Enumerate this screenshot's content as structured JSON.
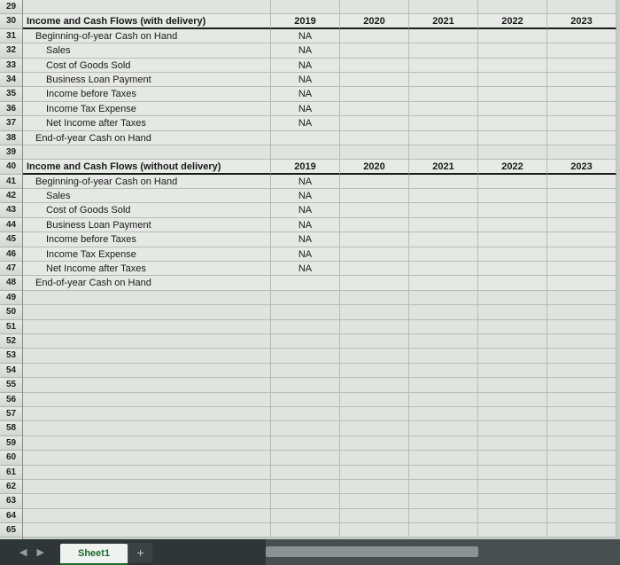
{
  "rows": [
    {
      "n": 29,
      "type": "blank",
      "label": "",
      "cells": [
        "",
        "",
        "",
        "",
        ""
      ]
    },
    {
      "n": 30,
      "type": "header",
      "label": "Income and Cash Flows (with delivery)",
      "cells": [
        "2019",
        "2020",
        "2021",
        "2022",
        "2023"
      ]
    },
    {
      "n": 31,
      "type": "data",
      "indent": 1,
      "label": "Beginning-of-year Cash on Hand",
      "cells": [
        "NA",
        "",
        "",
        "",
        ""
      ]
    },
    {
      "n": 32,
      "type": "data",
      "indent": 2,
      "label": "Sales",
      "cells": [
        "NA",
        "",
        "",
        "",
        ""
      ]
    },
    {
      "n": 33,
      "type": "data",
      "indent": 2,
      "label": "Cost of Goods Sold",
      "cells": [
        "NA",
        "",
        "",
        "",
        ""
      ]
    },
    {
      "n": 34,
      "type": "data",
      "indent": 2,
      "label": "Business Loan Payment",
      "cells": [
        "NA",
        "",
        "",
        "",
        ""
      ]
    },
    {
      "n": 35,
      "type": "data",
      "indent": 2,
      "label": "Income before Taxes",
      "cells": [
        "NA",
        "",
        "",
        "",
        ""
      ]
    },
    {
      "n": 36,
      "type": "data",
      "indent": 2,
      "label": "Income Tax Expense",
      "cells": [
        "NA",
        "",
        "",
        "",
        ""
      ]
    },
    {
      "n": 37,
      "type": "data",
      "indent": 2,
      "label": "Net Income after Taxes",
      "cells": [
        "NA",
        "",
        "",
        "",
        ""
      ]
    },
    {
      "n": 38,
      "type": "data",
      "indent": 1,
      "label": "End-of-year Cash on Hand",
      "cells": [
        "",
        "",
        "",
        "",
        ""
      ]
    },
    {
      "n": 39,
      "type": "blank",
      "label": "",
      "cells": [
        "",
        "",
        "",
        "",
        ""
      ]
    },
    {
      "n": 40,
      "type": "header",
      "label": "Income and Cash Flows (without delivery)",
      "cells": [
        "2019",
        "2020",
        "2021",
        "2022",
        "2023"
      ]
    },
    {
      "n": 41,
      "type": "data",
      "indent": 1,
      "label": "Beginning-of-year Cash on Hand",
      "cells": [
        "NA",
        "",
        "",
        "",
        ""
      ]
    },
    {
      "n": 42,
      "type": "data",
      "indent": 2,
      "label": "Sales",
      "cells": [
        "NA",
        "",
        "",
        "",
        ""
      ]
    },
    {
      "n": 43,
      "type": "data",
      "indent": 2,
      "label": "Cost of Goods Sold",
      "cells": [
        "NA",
        "",
        "",
        "",
        ""
      ]
    },
    {
      "n": 44,
      "type": "data",
      "indent": 2,
      "label": "Business Loan Payment",
      "cells": [
        "NA",
        "",
        "",
        "",
        ""
      ]
    },
    {
      "n": 45,
      "type": "data",
      "indent": 2,
      "label": "Income before Taxes",
      "cells": [
        "NA",
        "",
        "",
        "",
        ""
      ]
    },
    {
      "n": 46,
      "type": "data",
      "indent": 2,
      "label": "Income Tax Expense",
      "cells": [
        "NA",
        "",
        "",
        "",
        ""
      ]
    },
    {
      "n": 47,
      "type": "data",
      "indent": 2,
      "label": "Net Income after Taxes",
      "cells": [
        "NA",
        "",
        "",
        "",
        ""
      ]
    },
    {
      "n": 48,
      "type": "data",
      "indent": 1,
      "label": "End-of-year Cash on Hand",
      "cells": [
        "",
        "",
        "",
        "",
        ""
      ]
    },
    {
      "n": 49,
      "type": "blank",
      "label": "",
      "cells": [
        "",
        "",
        "",
        "",
        ""
      ]
    },
    {
      "n": 50,
      "type": "blank",
      "label": "",
      "cells": [
        "",
        "",
        "",
        "",
        ""
      ]
    },
    {
      "n": 51,
      "type": "blank",
      "label": "",
      "cells": [
        "",
        "",
        "",
        "",
        ""
      ]
    },
    {
      "n": 52,
      "type": "blank",
      "label": "",
      "cells": [
        "",
        "",
        "",
        "",
        ""
      ]
    },
    {
      "n": 53,
      "type": "blank",
      "label": "",
      "cells": [
        "",
        "",
        "",
        "",
        ""
      ]
    },
    {
      "n": 54,
      "type": "blank",
      "label": "",
      "cells": [
        "",
        "",
        "",
        "",
        ""
      ]
    },
    {
      "n": 55,
      "type": "blank",
      "label": "",
      "cells": [
        "",
        "",
        "",
        "",
        ""
      ]
    },
    {
      "n": 56,
      "type": "blank",
      "label": "",
      "cells": [
        "",
        "",
        "",
        "",
        ""
      ]
    },
    {
      "n": 57,
      "type": "blank",
      "label": "",
      "cells": [
        "",
        "",
        "",
        "",
        ""
      ]
    },
    {
      "n": 58,
      "type": "blank",
      "label": "",
      "cells": [
        "",
        "",
        "",
        "",
        ""
      ]
    },
    {
      "n": 59,
      "type": "blank",
      "label": "",
      "cells": [
        "",
        "",
        "",
        "",
        ""
      ]
    },
    {
      "n": 60,
      "type": "blank",
      "label": "",
      "cells": [
        "",
        "",
        "",
        "",
        ""
      ]
    },
    {
      "n": 61,
      "type": "blank",
      "label": "",
      "cells": [
        "",
        "",
        "",
        "",
        ""
      ]
    },
    {
      "n": 62,
      "type": "blank",
      "label": "",
      "cells": [
        "",
        "",
        "",
        "",
        ""
      ]
    },
    {
      "n": 63,
      "type": "blank",
      "label": "",
      "cells": [
        "",
        "",
        "",
        "",
        ""
      ]
    },
    {
      "n": 64,
      "type": "blank",
      "label": "",
      "cells": [
        "",
        "",
        "",
        "",
        ""
      ]
    },
    {
      "n": 65,
      "type": "blank",
      "label": "",
      "cells": [
        "",
        "",
        "",
        "",
        ""
      ]
    }
  ],
  "tabbar": {
    "nav": "◀ ▶",
    "active_tab": "Sheet1",
    "add": "+"
  }
}
